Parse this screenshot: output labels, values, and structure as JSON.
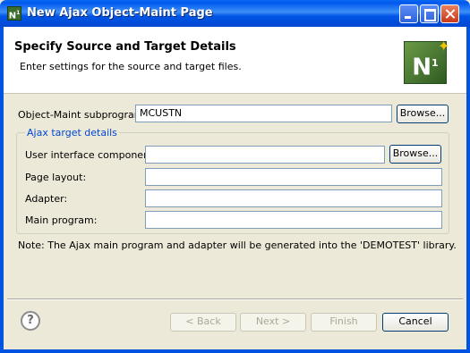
{
  "window": {
    "title": "New Ajax Object-Maint Page",
    "icon": "natural-n1-icon"
  },
  "header": {
    "title": "Specify Source and Target Details",
    "subtitle": "Enter settings for the source and target files.",
    "logo_text": "N",
    "logo_sup": "1"
  },
  "form": {
    "subprogram_label": "Object-Maint subprogram:",
    "subprogram_value": "MCUSTN",
    "browse_label": "Browse...",
    "group_title": "Ajax target details",
    "ui_component_label": "User interface component:",
    "ui_component_value": "",
    "page_layout_label": "Page layout:",
    "page_layout_value": "",
    "adapter_label": "Adapter:",
    "adapter_value": "",
    "main_program_label": "Main program:",
    "main_program_value": "",
    "note": "Note: The Ajax main program and adapter will be generated into the 'DEMOTEST' library."
  },
  "footer": {
    "back_label": "< Back",
    "next_label": "Next >",
    "finish_label": "Finish",
    "cancel_label": "Cancel",
    "help_icon": "help-icon"
  }
}
